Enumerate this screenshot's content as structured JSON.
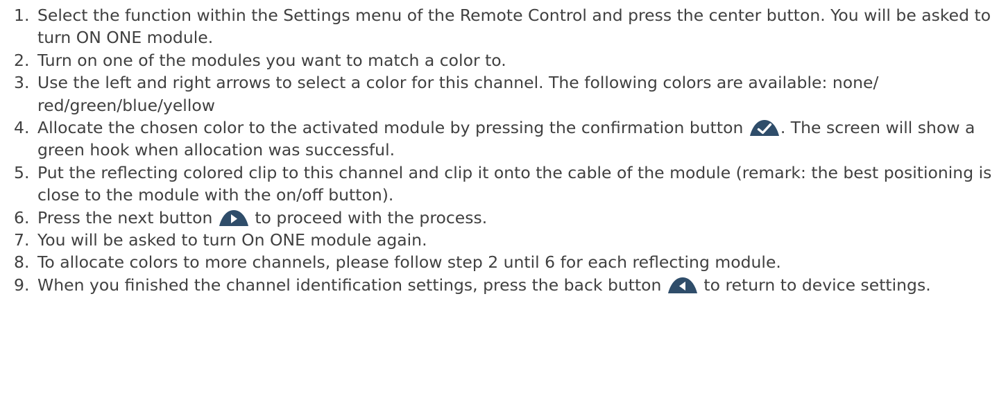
{
  "steps": [
    {
      "num": "1.",
      "text": "Select the function within the Settings menu of the Remote Control and press the center button. You will be asked to turn ON ONE module."
    },
    {
      "num": "2.",
      "text": "Turn on one of the modules you want to match a color to."
    },
    {
      "num": "3.",
      "text": "Use the left and right arrows to select a color for this channel. The following colors are available: none/ red/green/blue/yellow"
    },
    {
      "num": "4.",
      "text_before": "Allocate the chosen color to the activated module by pressing the confirmation button ",
      "icon": "confirm-check-icon",
      "text_after": ". The screen will show a green hook when allocation was successful."
    },
    {
      "num": "5.",
      "text": "Put the reflecting colored clip to this channel and clip it onto the cable of the module (remark: the best positioning is close to the module with the on/off button)."
    },
    {
      "num": "6.",
      "text_before": "Press the next button ",
      "icon": "next-arrow-icon",
      "text_after": " to proceed with the process."
    },
    {
      "num": "7.",
      "text": "You will be asked to turn On ONE module again."
    },
    {
      "num": "8.",
      "text": "To allocate colors to more channels, please follow step 2 until 6 for each reflecting module."
    },
    {
      "num": "9.",
      "text_before": "When you finished the channel identification settings, press the back button ",
      "icon": "back-arrow-icon",
      "text_after": " to return to device settings."
    }
  ],
  "icon_color": "#2f4d6a"
}
